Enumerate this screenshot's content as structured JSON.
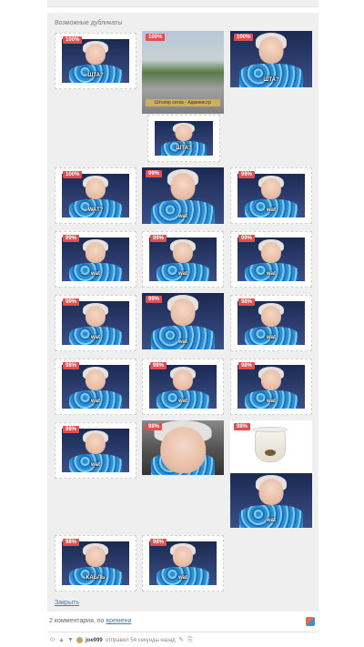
{
  "panel": {
    "title": "Возможные дубликаты",
    "close_label": "Закрыть"
  },
  "thumbs": [
    {
      "badge": "100%",
      "caption": "ШТА?",
      "kind": "meme"
    },
    {
      "badge": "100%",
      "caption": "",
      "kind": "street",
      "sign": "Штопор сетка - Администр"
    },
    {
      "badge": "100%",
      "caption": "ШТА?",
      "kind": "meme"
    },
    {
      "badge": "",
      "caption": "ШТА?",
      "kind": "meme"
    },
    {
      "badge": "100%",
      "caption": "WAT?",
      "kind": "meme"
    },
    {
      "badge": "99%",
      "caption": "wat",
      "kind": "meme"
    },
    {
      "badge": "99%",
      "caption": "wat",
      "kind": "meme"
    },
    {
      "badge": "99%",
      "caption": "wat",
      "kind": "meme"
    },
    {
      "badge": "99%",
      "caption": "wat",
      "kind": "meme"
    },
    {
      "badge": "99%",
      "caption": "wat",
      "kind": "meme"
    },
    {
      "badge": "99%",
      "caption": "wat",
      "kind": "meme"
    },
    {
      "badge": "99%",
      "caption": "wat",
      "kind": "meme"
    },
    {
      "badge": "98%",
      "caption": "wat",
      "kind": "meme"
    },
    {
      "badge": "98%",
      "caption": "wat",
      "kind": "meme"
    },
    {
      "badge": "98%",
      "caption": "wat",
      "kind": "meme"
    },
    {
      "badge": "98%",
      "caption": "wat",
      "kind": "meme"
    },
    {
      "badge": "98%",
      "caption": "wat",
      "kind": "meme"
    },
    {
      "badge": "98%",
      "caption": "",
      "kind": "bigface"
    },
    {
      "badge": "98%",
      "caption": "",
      "kind": "cup"
    },
    {
      "badge": "",
      "caption": "wat",
      "kind": "meme"
    },
    {
      "badge": "98%",
      "caption": "КАБЛЬ",
      "kind": "meme"
    },
    {
      "badge": "98%",
      "caption": "wat",
      "kind": "meme"
    }
  ],
  "comments": {
    "count": "2 комментария, по",
    "sort": "времени"
  },
  "comment": {
    "user": "joe999",
    "meta": "отправил 54 секунды назад"
  },
  "colors": {
    "badge": "#e05050",
    "link": "#4a78b0",
    "panel": "#efefef"
  }
}
